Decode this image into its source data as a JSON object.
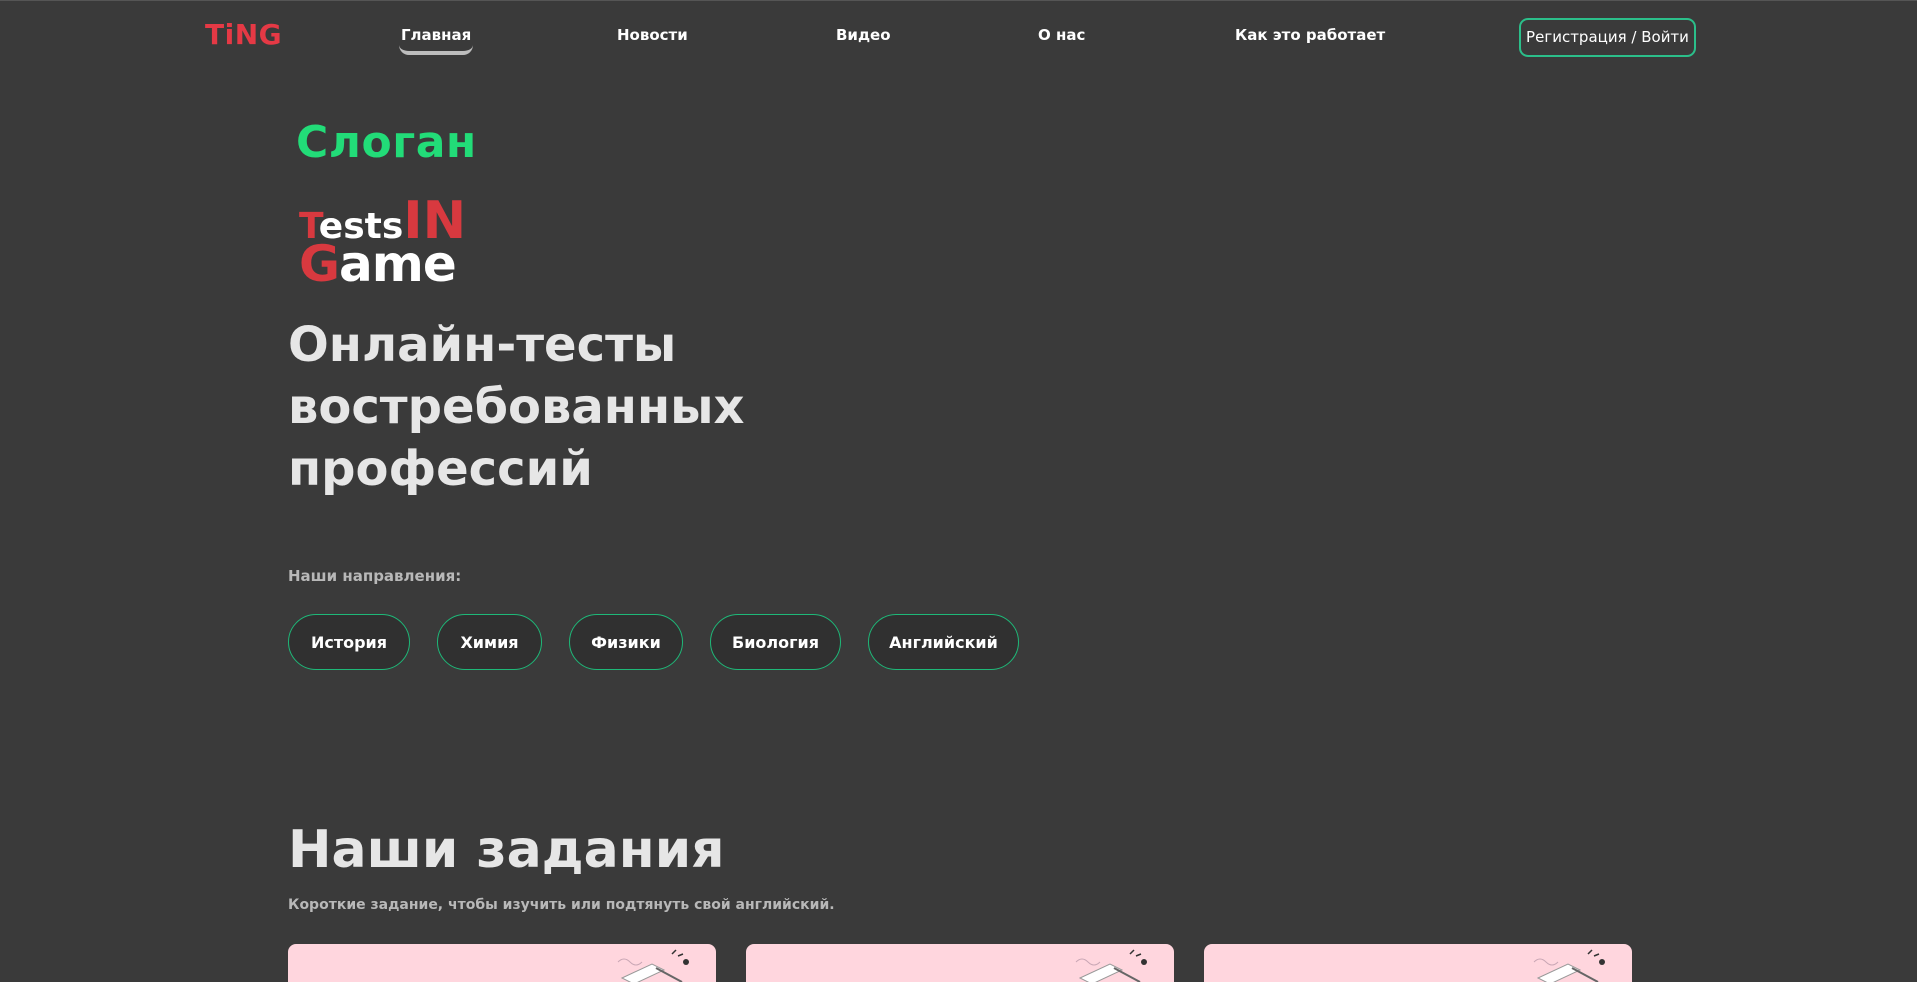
{
  "header": {
    "logo_text": "TiNG",
    "nav": [
      {
        "label": "Главная",
        "active": true
      },
      {
        "label": "Новости",
        "active": false
      },
      {
        "label": "Видео",
        "active": false
      },
      {
        "label": "О нас",
        "active": false
      },
      {
        "label": "Как это работает",
        "active": false
      }
    ],
    "login_label": "Регистрация / Войти"
  },
  "hero": {
    "slogan": "Слоган",
    "brand": {
      "tests_first": "T",
      "tests_rest": "ests",
      "in": "IN",
      "game_first": "G",
      "game_rest": "ame"
    },
    "title_lines": [
      "Онлайн-тесты",
      "востребованных",
      "профессий"
    ],
    "directions_label": "Наши направления:",
    "directions": [
      "История",
      "Химия",
      "Физики",
      "Биология",
      "Английский"
    ]
  },
  "tasks": {
    "title": "Наши задания",
    "subtitle": "Короткие задание, чтобы изучить или подтянуть свой английский."
  },
  "colors": {
    "background": "#3a3a3a",
    "accent_green": "#22dc78",
    "chip_border": "#1eb878",
    "brand_red": "#d8393f",
    "card_pink": "#ffd6de"
  }
}
